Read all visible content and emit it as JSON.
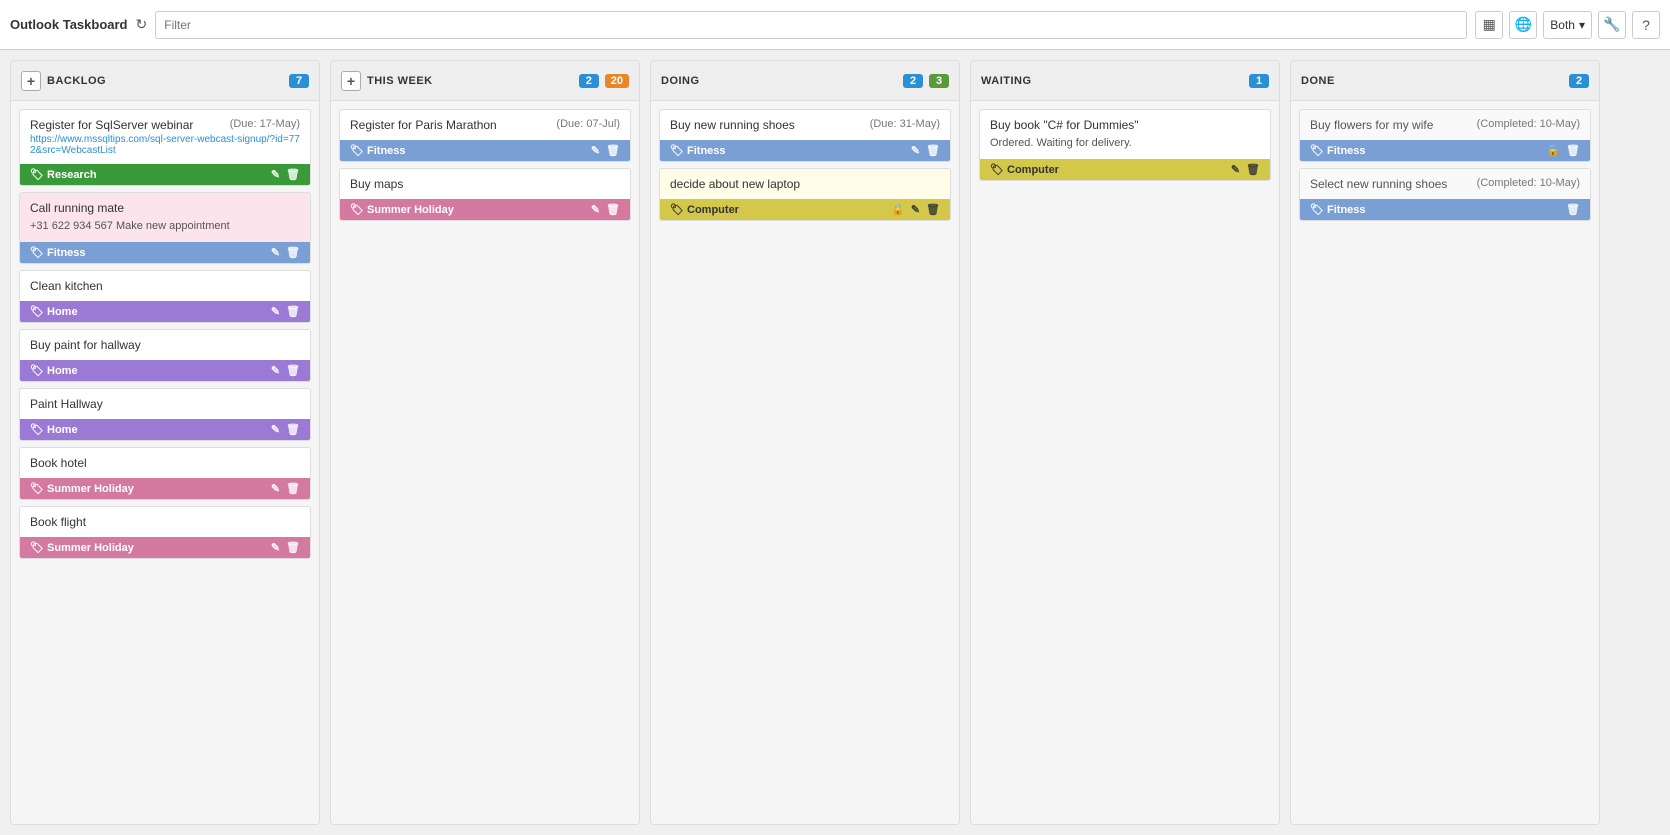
{
  "topbar": {
    "app_title": "Outlook Taskboard",
    "filter_placeholder": "Filter",
    "both_label": "Both"
  },
  "columns": [
    {
      "id": "backlog",
      "title": "BACKLOG",
      "badge_count": "7",
      "badge_color": "badge-blue",
      "has_add": true,
      "cards": [
        {
          "id": "register-sqlserver",
          "title": "Register for SqlServer webinar",
          "due": "(Due: 17-May)",
          "link": "https://www.mssqltips.com/sql-server-webcast-signup/?id=772&src=WebcastList",
          "tag": "Research",
          "tag_class": "tag-research",
          "has_edit": true,
          "has_delete": true
        },
        {
          "id": "call-running-mate",
          "title": "Call running mate",
          "subtitle": "+31 622 934 567 Make new appointment",
          "tag": "Fitness",
          "tag_class": "tag-fitness",
          "bg": "card-pink",
          "has_edit": true,
          "has_delete": true
        },
        {
          "id": "clean-kitchen",
          "title": "Clean kitchen",
          "tag": "Home",
          "tag_class": "tag-home",
          "has_edit": true,
          "has_delete": true
        },
        {
          "id": "buy-paint-hallway",
          "title": "Buy paint for hallway",
          "tag": "Home",
          "tag_class": "tag-home",
          "has_edit": true,
          "has_delete": true
        },
        {
          "id": "paint-hallway",
          "title": "Paint Hallway",
          "tag": "Home",
          "tag_class": "tag-home",
          "has_edit": true,
          "has_delete": true
        },
        {
          "id": "book-hotel",
          "title": "Book hotel",
          "tag": "Summer Holiday",
          "tag_class": "tag-summer",
          "has_edit": true,
          "has_delete": true
        },
        {
          "id": "book-flight",
          "title": "Book flight",
          "tag": "Summer Holiday",
          "tag_class": "tag-summer",
          "has_edit": true,
          "has_delete": true
        }
      ]
    },
    {
      "id": "this-week",
      "title": "THIS WEEK",
      "badge1_count": "2",
      "badge1_color": "badge-blue",
      "badge2_count": "20",
      "badge2_color": "badge-orange",
      "has_add": true,
      "cards": [
        {
          "id": "register-paris-marathon",
          "title": "Register for Paris Marathon",
          "due": "(Due: 07-Jul)",
          "tag": "Fitness",
          "tag_class": "tag-fitness",
          "has_edit": true,
          "has_delete": true
        },
        {
          "id": "buy-maps",
          "title": "Buy maps",
          "tag": "Summer Holiday",
          "tag_class": "tag-summer",
          "has_edit": true,
          "has_delete": true
        }
      ]
    },
    {
      "id": "doing",
      "title": "DOING",
      "badge1_count": "2",
      "badge1_color": "badge-blue",
      "badge2_count": "3",
      "badge2_color": "badge-green",
      "has_add": false,
      "cards": [
        {
          "id": "buy-running-shoes",
          "title": "Buy new running shoes",
          "due": "(Due: 31-May)",
          "tag": "Fitness",
          "tag_class": "tag-fitness",
          "has_edit": true,
          "has_delete": true
        },
        {
          "id": "decide-laptop",
          "title": "decide about new laptop",
          "bg": "card-yellow",
          "tag": "Computer",
          "tag_class": "tag-computer",
          "has_lock": true,
          "has_edit": true,
          "has_delete": true
        }
      ]
    },
    {
      "id": "waiting",
      "title": "WAITING",
      "badge1_count": "1",
      "badge1_color": "badge-blue",
      "has_add": false,
      "cards": [
        {
          "id": "buy-book-csharp",
          "title": "Buy book \"C# for Dummies\"",
          "subtitle": "Ordered. Waiting for delivery.",
          "tag": "Computer",
          "tag_class": "tag-computer",
          "has_edit": true,
          "has_delete": true
        }
      ]
    },
    {
      "id": "done",
      "title": "DONE",
      "badge1_count": "2",
      "badge1_color": "badge-blue",
      "has_add": false,
      "cards": [
        {
          "id": "buy-flowers-wife",
          "title": "Buy flowers for my wife",
          "due": "(Completed: 10-May)",
          "tag": "Fitness",
          "tag_class": "tag-fitness",
          "has_lock": true,
          "has_delete": true,
          "done": true
        },
        {
          "id": "select-running-shoes",
          "title": "Select new running shoes",
          "due": "(Completed: 10-May)",
          "tag": "Fitness",
          "tag_class": "tag-fitness",
          "has_delete": true,
          "done": true
        }
      ]
    }
  ]
}
